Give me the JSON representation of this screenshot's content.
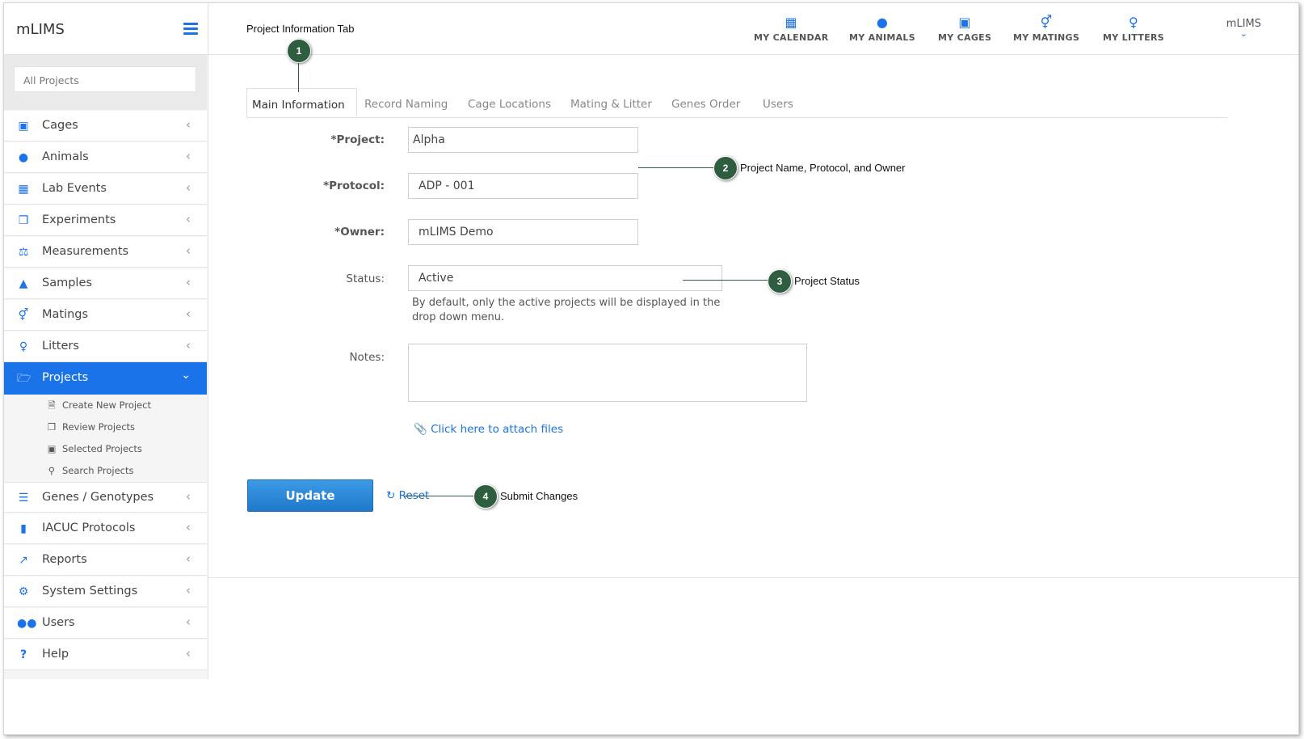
{
  "app": {
    "name": "mLIMS"
  },
  "sidebar": {
    "search_placeholder": "All Projects",
    "items": [
      {
        "label": "Cages",
        "icon": "cube-icon"
      },
      {
        "label": "Animals",
        "icon": "paw-icon"
      },
      {
        "label": "Lab Events",
        "icon": "calendar-icon"
      },
      {
        "label": "Experiments",
        "icon": "files-icon"
      },
      {
        "label": "Measurements",
        "icon": "scale-icon"
      },
      {
        "label": "Samples",
        "icon": "flask-icon"
      },
      {
        "label": "Matings",
        "icon": "mating-icon"
      },
      {
        "label": "Litters",
        "icon": "litter-icon"
      },
      {
        "label": "Projects",
        "icon": "folder-open-icon"
      },
      {
        "label": "Genes / Genotypes",
        "icon": "list-icon"
      },
      {
        "label": "IACUC Protocols",
        "icon": "book-icon"
      },
      {
        "label": "Reports",
        "icon": "chart-icon"
      },
      {
        "label": "System Settings",
        "icon": "gear-icon"
      },
      {
        "label": "Users",
        "icon": "users-icon"
      },
      {
        "label": "Help",
        "icon": "question-icon"
      }
    ],
    "project_subitems": [
      {
        "label": "Create New Project",
        "icon": "file-icon"
      },
      {
        "label": "Review Projects",
        "icon": "copy-icon"
      },
      {
        "label": "Selected Projects",
        "icon": "cart-icon"
      },
      {
        "label": "Search Projects",
        "icon": "search-icon"
      }
    ]
  },
  "header": {
    "nav": [
      {
        "label": "MY CALENDAR",
        "icon": "calendar-icon"
      },
      {
        "label": "MY ANIMALS",
        "icon": "paw-icon"
      },
      {
        "label": "MY CAGES",
        "icon": "cube-icon"
      },
      {
        "label": "MY MATINGS",
        "icon": "mating-icon"
      },
      {
        "label": "MY LITTERS",
        "icon": "litter-icon"
      }
    ],
    "user": "mLIMS"
  },
  "tabs": [
    "Main Information",
    "Record Naming",
    "Cage Locations",
    "Mating & Litter",
    "Genes Order",
    "Users"
  ],
  "form": {
    "project_label": "*Project:",
    "project_value": "Alpha",
    "protocol_label": "*Protocol:",
    "protocol_value": "ADP - 001",
    "owner_label": "*Owner:",
    "owner_value": "mLIMS Demo",
    "status_label": "Status:",
    "status_value": "Active",
    "status_help": "By default, only the active projects will be displayed in the drop down menu.",
    "notes_label": "Notes:",
    "attach_label": "Click here to attach files",
    "update_label": "Update",
    "reset_label": "Reset"
  },
  "annotations": [
    {
      "num": "1",
      "text": "Project Information Tab"
    },
    {
      "num": "2",
      "text": "Project Name, Protocol,  and Owner"
    },
    {
      "num": "3",
      "text": "Project Status"
    },
    {
      "num": "4",
      "text": "Submit Changes"
    }
  ]
}
